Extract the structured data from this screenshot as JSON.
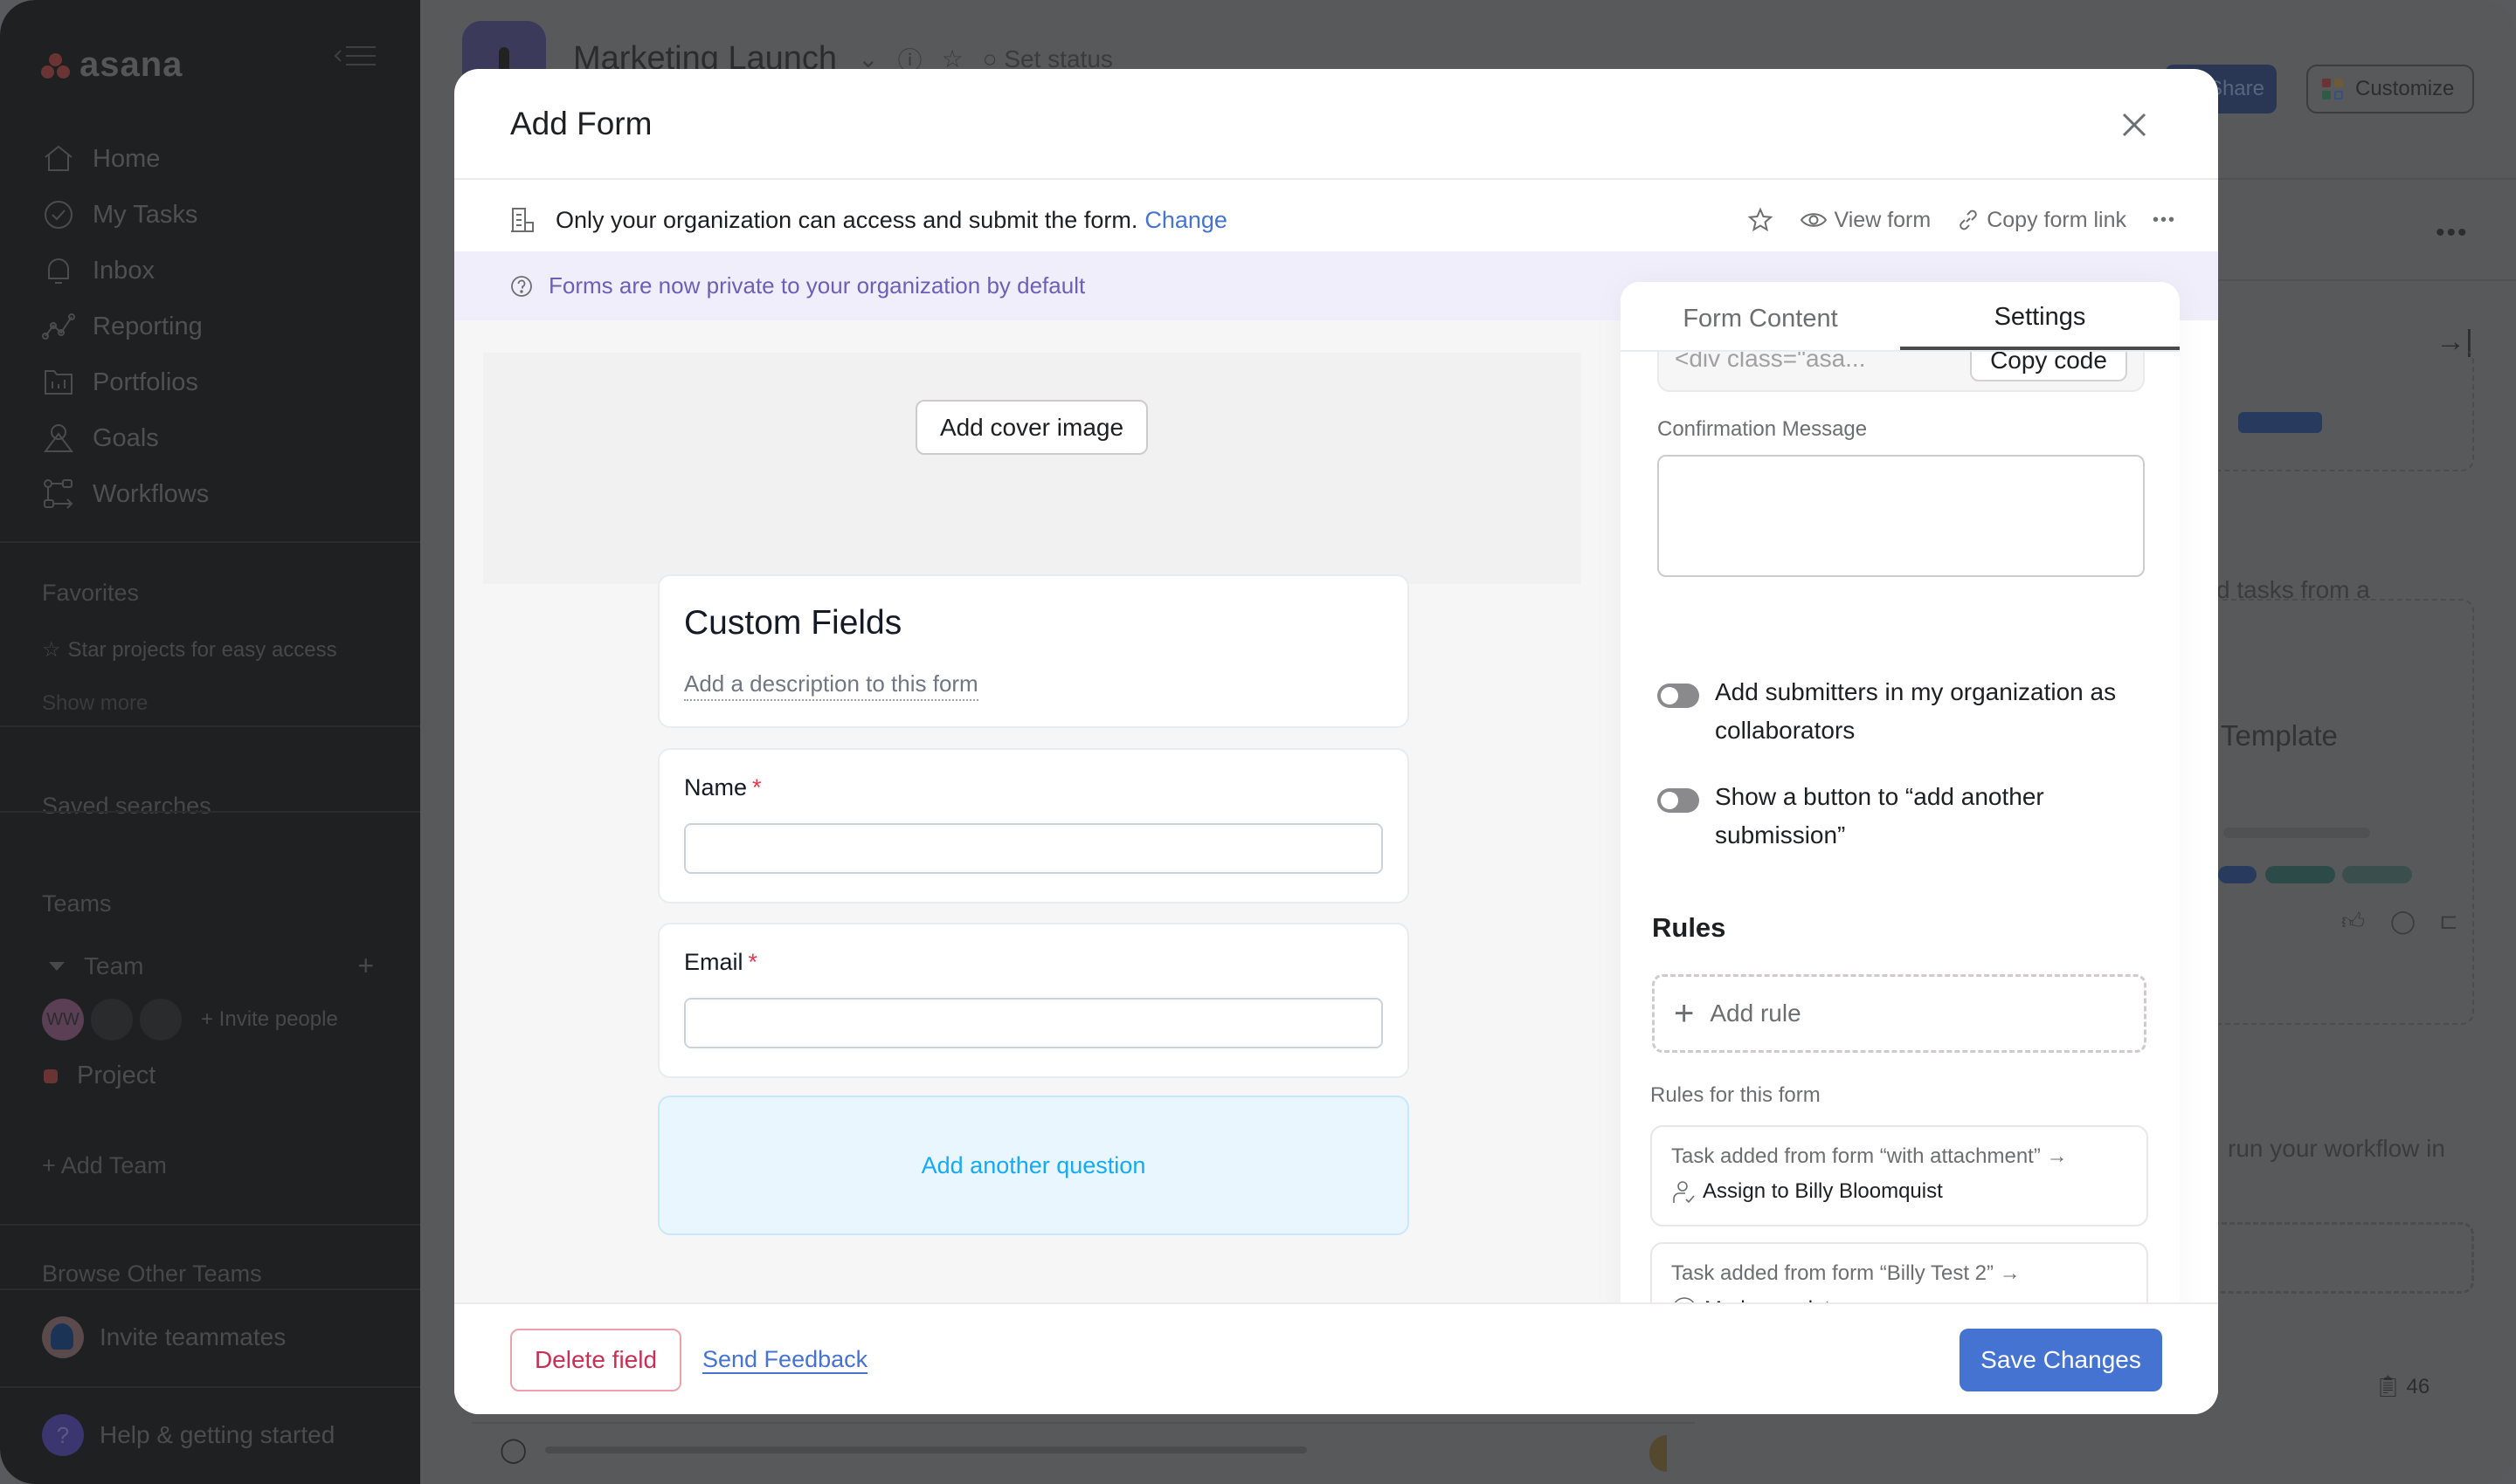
{
  "sidebar": {
    "logo_text": "asana",
    "nav": [
      {
        "label": "Home",
        "icon": "home-icon"
      },
      {
        "label": "My Tasks",
        "icon": "check-circle-icon"
      },
      {
        "label": "Inbox",
        "icon": "bell-icon"
      },
      {
        "label": "Reporting",
        "icon": "line-chart-icon"
      },
      {
        "label": "Portfolios",
        "icon": "folder-chart-icon"
      },
      {
        "label": "Goals",
        "icon": "person-goal-icon"
      },
      {
        "label": "Workflows",
        "icon": "workflow-icon"
      }
    ],
    "favorites_heading": "Favorites",
    "favorites_hint": "Star projects for easy access",
    "show_more": "Show more",
    "saved_searches": "Saved searches",
    "teams_heading": "Teams",
    "team_name": "Team",
    "avatar_initials": "WW",
    "invite_people": "+ Invite people",
    "project_name": "Project",
    "add_team": "+ Add Team",
    "browse_teams": "Browse Other Teams",
    "invite_teammates": "Invite teammates",
    "help": "Help & getting started",
    "help_glyph": "?"
  },
  "background": {
    "project_title": "Marketing Launch",
    "set_status": "Set status",
    "share_label": "Share",
    "customize_label": "Customize",
    "text_tasks_from": "d tasks from a",
    "text_template": "Template",
    "text_run_workflow": "run your workflow in",
    "count": "46"
  },
  "modal": {
    "title": "Add Form",
    "access_text": "Only your organization can access and submit the form.",
    "access_change": "Change",
    "actions": {
      "view_form": "View form",
      "copy_form_link": "Copy form link",
      "more": "•••"
    },
    "banner": "Forms are now private to your organization by default",
    "cover_button": "Add cover image",
    "form": {
      "title": "Custom Fields",
      "description_placeholder": "Add a description to this form",
      "fields": [
        {
          "label": "Name",
          "required_mark": "*",
          "value": ""
        },
        {
          "label": "Email",
          "required_mark": "*",
          "value": ""
        }
      ],
      "add_question": "Add another question"
    },
    "settings": {
      "tabs": [
        {
          "label": "Form Content",
          "active": false
        },
        {
          "label": "Settings",
          "active": true
        }
      ],
      "embed_code": "<div class=\"asa...",
      "copy_code": "Copy code",
      "confirmation_label": "Confirmation Message",
      "confirmation_value": "",
      "toggles": [
        {
          "label": "Add submitters in my organization as collaborators",
          "on": false
        },
        {
          "label": "Show a button to “add another submission”",
          "on": false
        }
      ],
      "rules_heading": "Rules",
      "add_rule": "Add rule",
      "rules_subheading": "Rules for this form",
      "rules": [
        {
          "trigger": "Task added from form “with attachment” →",
          "action": "Assign to Billy Bloomquist",
          "icon": "assign-user-icon"
        },
        {
          "trigger": "Task added from form “Billy Test 2” →",
          "action": "Mark complete",
          "icon": "check-circle-icon"
        }
      ]
    },
    "footer": {
      "delete": "Delete field",
      "feedback": "Send Feedback",
      "save": "Save Changes"
    }
  },
  "colors": {
    "primary": "#4573d2",
    "danger": "#c92f54",
    "banner_text": "#6d5fb7",
    "banner_bg": "#f0eefa",
    "add_question": "#14aaf5",
    "required": "#e8384f"
  }
}
